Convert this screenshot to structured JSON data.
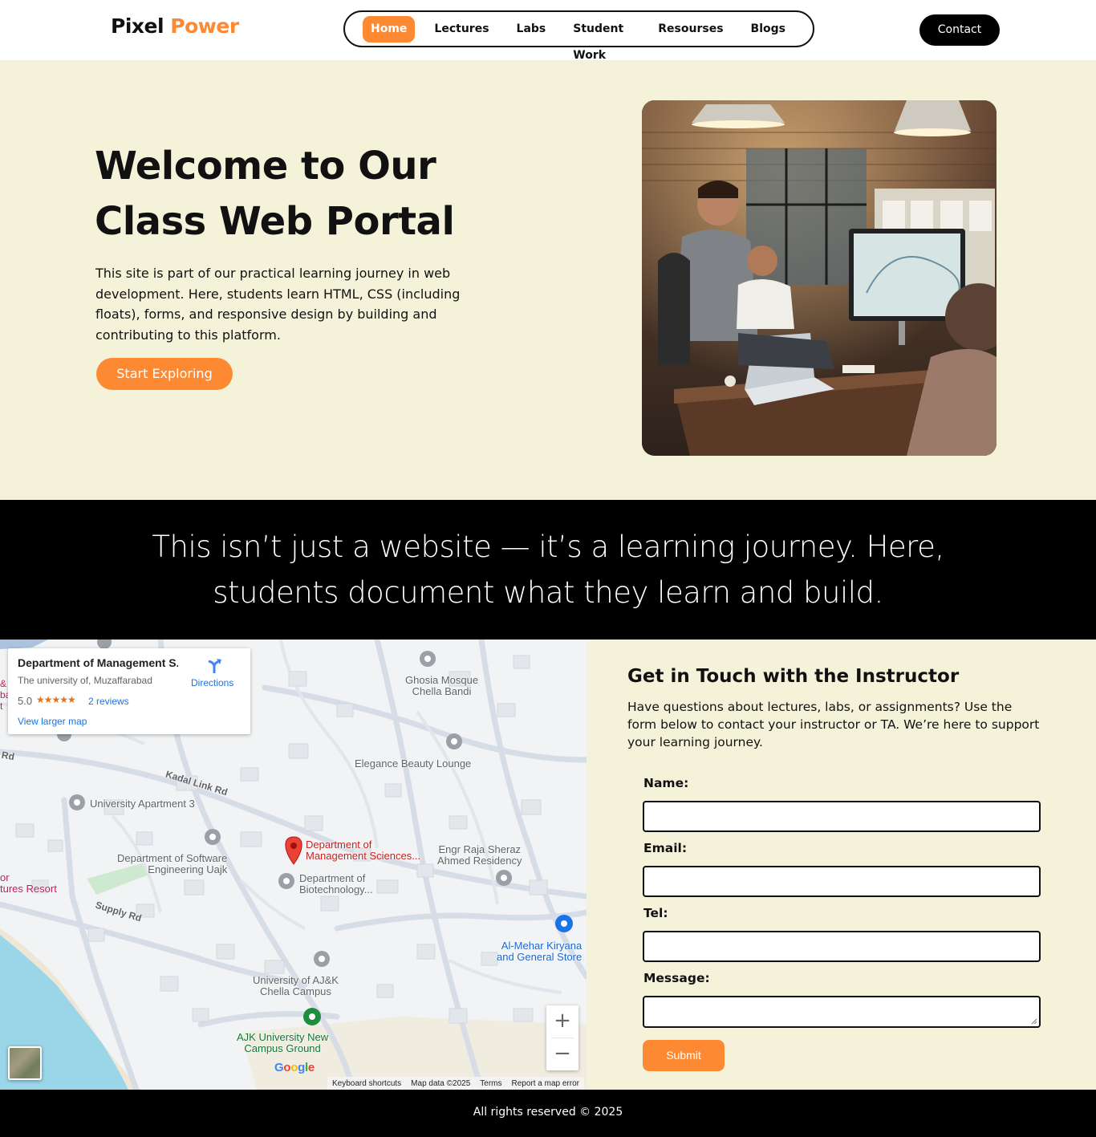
{
  "header": {
    "logo_part1": "Pixel",
    "logo_part2": "Power",
    "nav": [
      "Home",
      "Lectures",
      "Labs",
      "Student Work",
      "Resourses",
      "Blogs"
    ],
    "active_nav": "Home",
    "contact_label": "Contact"
  },
  "hero": {
    "title": "Welcome to Our Class Web Portal",
    "text": "This site is part of our practical learning journey in web development. Here, students learn HTML, CSS (including floats), forms, and responsive design by building and contributing to this platform.",
    "cta_label": "Start Exploring"
  },
  "banner": {
    "text": "This isn’t just a website — it’s a learning journey. Here, students document what they learn and build."
  },
  "map": {
    "place_title": "Department of Management S...",
    "place_subtitle": "The university of, Muzaffarabad",
    "rating": "5.0",
    "stars": "★★★★★",
    "reviews": "2 reviews",
    "view_larger": "View larger map",
    "directions": "Directions",
    "labels": {
      "ghosia": "Ghosia Mosque\nChella Bandi",
      "elegance": "Elegance Beauty Lounge",
      "univ_apt": "University Apartment 3",
      "dept_soft": "Department of Software\nEngineering Uajk",
      "dept_mgmt": "Department of\nManagement Sciences...",
      "engr_raja": "Engr Raja Sheraz\nAhmed Residency",
      "dept_bio": "Department of\nBiotechnology...",
      "al_mehar": "Al-Mehar Kiryana\nand General Store",
      "univ_ajk": "University of AJ&K\nChella Campus",
      "ajk_ground": "AJK University New\nCampus Ground",
      "resort": "or\ntures Resort",
      "left_edge": "&\nba\nt"
    },
    "roads": {
      "kadal": "Kadal Link Rd",
      "supply": "Supply Rd",
      "rd": "Rd"
    },
    "zoom_in": "+",
    "zoom_out": "−",
    "google": [
      "G",
      "o",
      "o",
      "g",
      "l",
      "e"
    ],
    "google_colors": [
      "#4285F4",
      "#EA4335",
      "#FBBC05",
      "#4285F4",
      "#34A853",
      "#EA4335"
    ],
    "attribution": [
      "Keyboard shortcuts",
      "Map data ©2025",
      "Terms",
      "Report a map error"
    ]
  },
  "contact": {
    "title": "Get in Touch with the Instructor",
    "text": "Have questions about lectures, labs, or assignments? Use the form below to contact your instructor or TA. We’re here to support your learning journey.",
    "fields": [
      {
        "label": "Name:",
        "value": ""
      },
      {
        "label": "Email:",
        "value": ""
      },
      {
        "label": "Tel:",
        "value": ""
      },
      {
        "label": "Message:",
        "value": ""
      }
    ],
    "submit_label": "Submit"
  },
  "footer": {
    "text": "All rights reserved © 2025"
  },
  "colors": {
    "accent": "#fd8a33",
    "hero_bg": "#f4f3da",
    "dark": "#000000"
  }
}
